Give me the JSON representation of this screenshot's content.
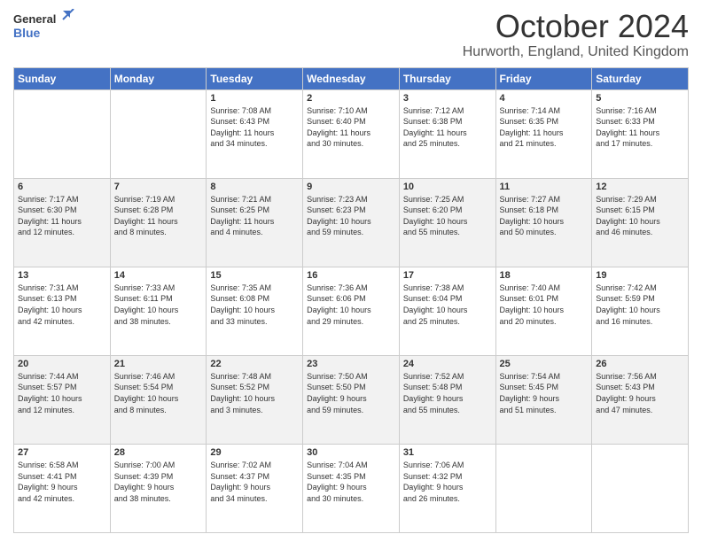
{
  "header": {
    "month_title": "October 2024",
    "location": "Hurworth, England, United Kingdom",
    "logo_line1": "General",
    "logo_line2": "Blue"
  },
  "days_of_week": [
    "Sunday",
    "Monday",
    "Tuesday",
    "Wednesday",
    "Thursday",
    "Friday",
    "Saturday"
  ],
  "weeks": [
    [
      {
        "day": "",
        "info": ""
      },
      {
        "day": "",
        "info": ""
      },
      {
        "day": "1",
        "info": "Sunrise: 7:08 AM\nSunset: 6:43 PM\nDaylight: 11 hours\nand 34 minutes."
      },
      {
        "day": "2",
        "info": "Sunrise: 7:10 AM\nSunset: 6:40 PM\nDaylight: 11 hours\nand 30 minutes."
      },
      {
        "day": "3",
        "info": "Sunrise: 7:12 AM\nSunset: 6:38 PM\nDaylight: 11 hours\nand 25 minutes."
      },
      {
        "day": "4",
        "info": "Sunrise: 7:14 AM\nSunset: 6:35 PM\nDaylight: 11 hours\nand 21 minutes."
      },
      {
        "day": "5",
        "info": "Sunrise: 7:16 AM\nSunset: 6:33 PM\nDaylight: 11 hours\nand 17 minutes."
      }
    ],
    [
      {
        "day": "6",
        "info": "Sunrise: 7:17 AM\nSunset: 6:30 PM\nDaylight: 11 hours\nand 12 minutes."
      },
      {
        "day": "7",
        "info": "Sunrise: 7:19 AM\nSunset: 6:28 PM\nDaylight: 11 hours\nand 8 minutes."
      },
      {
        "day": "8",
        "info": "Sunrise: 7:21 AM\nSunset: 6:25 PM\nDaylight: 11 hours\nand 4 minutes."
      },
      {
        "day": "9",
        "info": "Sunrise: 7:23 AM\nSunset: 6:23 PM\nDaylight: 10 hours\nand 59 minutes."
      },
      {
        "day": "10",
        "info": "Sunrise: 7:25 AM\nSunset: 6:20 PM\nDaylight: 10 hours\nand 55 minutes."
      },
      {
        "day": "11",
        "info": "Sunrise: 7:27 AM\nSunset: 6:18 PM\nDaylight: 10 hours\nand 50 minutes."
      },
      {
        "day": "12",
        "info": "Sunrise: 7:29 AM\nSunset: 6:15 PM\nDaylight: 10 hours\nand 46 minutes."
      }
    ],
    [
      {
        "day": "13",
        "info": "Sunrise: 7:31 AM\nSunset: 6:13 PM\nDaylight: 10 hours\nand 42 minutes."
      },
      {
        "day": "14",
        "info": "Sunrise: 7:33 AM\nSunset: 6:11 PM\nDaylight: 10 hours\nand 38 minutes."
      },
      {
        "day": "15",
        "info": "Sunrise: 7:35 AM\nSunset: 6:08 PM\nDaylight: 10 hours\nand 33 minutes."
      },
      {
        "day": "16",
        "info": "Sunrise: 7:36 AM\nSunset: 6:06 PM\nDaylight: 10 hours\nand 29 minutes."
      },
      {
        "day": "17",
        "info": "Sunrise: 7:38 AM\nSunset: 6:04 PM\nDaylight: 10 hours\nand 25 minutes."
      },
      {
        "day": "18",
        "info": "Sunrise: 7:40 AM\nSunset: 6:01 PM\nDaylight: 10 hours\nand 20 minutes."
      },
      {
        "day": "19",
        "info": "Sunrise: 7:42 AM\nSunset: 5:59 PM\nDaylight: 10 hours\nand 16 minutes."
      }
    ],
    [
      {
        "day": "20",
        "info": "Sunrise: 7:44 AM\nSunset: 5:57 PM\nDaylight: 10 hours\nand 12 minutes."
      },
      {
        "day": "21",
        "info": "Sunrise: 7:46 AM\nSunset: 5:54 PM\nDaylight: 10 hours\nand 8 minutes."
      },
      {
        "day": "22",
        "info": "Sunrise: 7:48 AM\nSunset: 5:52 PM\nDaylight: 10 hours\nand 3 minutes."
      },
      {
        "day": "23",
        "info": "Sunrise: 7:50 AM\nSunset: 5:50 PM\nDaylight: 9 hours\nand 59 minutes."
      },
      {
        "day": "24",
        "info": "Sunrise: 7:52 AM\nSunset: 5:48 PM\nDaylight: 9 hours\nand 55 minutes."
      },
      {
        "day": "25",
        "info": "Sunrise: 7:54 AM\nSunset: 5:45 PM\nDaylight: 9 hours\nand 51 minutes."
      },
      {
        "day": "26",
        "info": "Sunrise: 7:56 AM\nSunset: 5:43 PM\nDaylight: 9 hours\nand 47 minutes."
      }
    ],
    [
      {
        "day": "27",
        "info": "Sunrise: 6:58 AM\nSunset: 4:41 PM\nDaylight: 9 hours\nand 42 minutes."
      },
      {
        "day": "28",
        "info": "Sunrise: 7:00 AM\nSunset: 4:39 PM\nDaylight: 9 hours\nand 38 minutes."
      },
      {
        "day": "29",
        "info": "Sunrise: 7:02 AM\nSunset: 4:37 PM\nDaylight: 9 hours\nand 34 minutes."
      },
      {
        "day": "30",
        "info": "Sunrise: 7:04 AM\nSunset: 4:35 PM\nDaylight: 9 hours\nand 30 minutes."
      },
      {
        "day": "31",
        "info": "Sunrise: 7:06 AM\nSunset: 4:32 PM\nDaylight: 9 hours\nand 26 minutes."
      },
      {
        "day": "",
        "info": ""
      },
      {
        "day": "",
        "info": ""
      }
    ]
  ]
}
